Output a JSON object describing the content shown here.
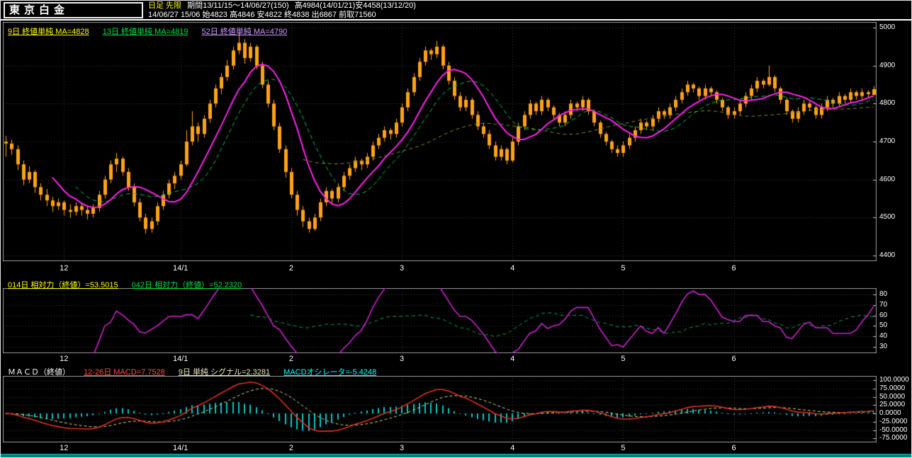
{
  "header": {
    "title": "東京白金",
    "timeframe": "日足 先限",
    "period": "期間13/11/15～14/06/27(150)",
    "period_high_low": "高4984(14/01/21)安4458(13/12/20)",
    "quote_line": "14/06/27 15/06 始4823 高4846 安4822 終4838 出6867 前取71560"
  },
  "colors": {
    "candle": "#ffa216",
    "ma9": "#ff22ee",
    "ma13": "#00c850",
    "ma52": "#8a8a20",
    "rsi14": "#cc22cc",
    "rsi42": "#00a050",
    "macd": "#e03020",
    "signal": "#d8d890",
    "histogram": "#00c8c8",
    "grid": "#3a3a3a",
    "frame": "#9a9a9a",
    "yellow": "#ffff00",
    "statusbar": "#008080"
  },
  "panels": {
    "main": {
      "legend": [
        {
          "label": "9日 終値単純 MA=4828",
          "color": "#ffff00"
        },
        {
          "label": "13日 終値単純 MA=4819",
          "color": "#00dd44"
        },
        {
          "label": "52日 終値単純 MA=4790",
          "color": "#cc99ff"
        }
      ],
      "y_ticks": [
        {
          "v": 5000,
          "label": "5000"
        },
        {
          "v": 4900,
          "label": "4900"
        },
        {
          "v": 4800,
          "label": "4800"
        },
        {
          "v": 4700,
          "label": "4700"
        },
        {
          "v": 4600,
          "label": "4600"
        },
        {
          "v": 4500,
          "label": "4500"
        },
        {
          "v": 4400,
          "label": "4400"
        }
      ]
    },
    "rsi": {
      "legend": [
        {
          "label": "014日 相対力（終値）=53.5015",
          "color": "#ffff00"
        },
        {
          "label": "042日 相対力（終値）=52.2320",
          "color": "#00dd44"
        }
      ],
      "y_ticks": [
        {
          "v": 80,
          "label": "80"
        },
        {
          "v": 70,
          "label": "70"
        },
        {
          "v": 60,
          "label": "60"
        },
        {
          "v": 50,
          "label": "50"
        },
        {
          "v": 40,
          "label": "40"
        },
        {
          "v": 30,
          "label": "30"
        }
      ]
    },
    "macd": {
      "legend": [
        {
          "label": "ＭＡＣＤ（終値）",
          "color": "#ffffff"
        },
        {
          "label": "12-26日 MACD=7.7528",
          "color": "#ff5040"
        },
        {
          "label": "9日 単純 シグナル=2.3281",
          "color": "#e8e8c0"
        },
        {
          "label": "MACDオシレータ=-5.4248",
          "color": "#00ffff"
        }
      ],
      "y_ticks": [
        {
          "v": 100,
          "label": "100.0000"
        },
        {
          "v": 75,
          "label": "75.0000"
        },
        {
          "v": 50,
          "label": "50.0000"
        },
        {
          "v": 25,
          "label": "25.0000"
        },
        {
          "v": 0,
          "label": "0.0000"
        },
        {
          "v": -25,
          "label": "-25.0000"
        },
        {
          "v": -50,
          "label": "-50.0000"
        },
        {
          "v": -75,
          "label": "-75.0000"
        }
      ]
    }
  },
  "chart_data": [
    {
      "type": "candlestick",
      "title": "東京白金 日足 先限",
      "ylim": [
        4400,
        5000
      ],
      "period_high": 4984,
      "period_low": 4458,
      "x_ticks": [
        {
          "label": "12",
          "i": 10
        },
        {
          "label": "14/1",
          "i": 30
        },
        {
          "label": "2",
          "i": 49
        },
        {
          "label": "3",
          "i": 68
        },
        {
          "label": "4",
          "i": 87
        },
        {
          "label": "5",
          "i": 106
        },
        {
          "label": "6",
          "i": 125
        }
      ],
      "moving_averages": [
        {
          "period": 9,
          "type": "終値単純",
          "last": 4828
        },
        {
          "period": 13,
          "type": "終値単純",
          "last": 4819
        },
        {
          "period": 52,
          "type": "終値単純",
          "last": 4790
        }
      ],
      "candles": [
        [
          4700,
          4715,
          4660,
          4695
        ],
        [
          4695,
          4705,
          4665,
          4680
        ],
        [
          4680,
          4690,
          4625,
          4640
        ],
        [
          4640,
          4650,
          4585,
          4600
        ],
        [
          4600,
          4635,
          4590,
          4620
        ],
        [
          4620,
          4625,
          4565,
          4580
        ],
        [
          4580,
          4590,
          4545,
          4560
        ],
        [
          4560,
          4575,
          4530,
          4545
        ],
        [
          4545,
          4555,
          4515,
          4530
        ],
        [
          4530,
          4550,
          4520,
          4540
        ],
        [
          4540,
          4545,
          4505,
          4520
        ],
        [
          4520,
          4535,
          4500,
          4515
        ],
        [
          4515,
          4540,
          4505,
          4530
        ],
        [
          4530,
          4540,
          4505,
          4520
        ],
        [
          4520,
          4530,
          4495,
          4510
        ],
        [
          4510,
          4535,
          4500,
          4525
        ],
        [
          4525,
          4570,
          4515,
          4560
        ],
        [
          4560,
          4610,
          4550,
          4600
        ],
        [
          4600,
          4650,
          4590,
          4640
        ],
        [
          4640,
          4670,
          4620,
          4655
        ],
        [
          4655,
          4660,
          4610,
          4620
        ],
        [
          4620,
          4630,
          4570,
          4580
        ],
        [
          4580,
          4590,
          4530,
          4540
        ],
        [
          4540,
          4550,
          4490,
          4500
        ],
        [
          4500,
          4510,
          4458,
          4470
        ],
        [
          4470,
          4500,
          4460,
          4490
        ],
        [
          4490,
          4540,
          4480,
          4530
        ],
        [
          4530,
          4570,
          4520,
          4560
        ],
        [
          4560,
          4600,
          4550,
          4590
        ],
        [
          4590,
          4620,
          4575,
          4610
        ],
        [
          4610,
          4650,
          4600,
          4640
        ],
        [
          4640,
          4730,
          4635,
          4700
        ],
        [
          4700,
          4780,
          4690,
          4740
        ],
        [
          4740,
          4750,
          4700,
          4720
        ],
        [
          4720,
          4770,
          4710,
          4760
        ],
        [
          4760,
          4810,
          4750,
          4800
        ],
        [
          4800,
          4850,
          4790,
          4840
        ],
        [
          4840,
          4880,
          4825,
          4870
        ],
        [
          4870,
          4915,
          4860,
          4900
        ],
        [
          4900,
          4950,
          4890,
          4940
        ],
        [
          4940,
          4984,
          4930,
          4960
        ],
        [
          4960,
          4970,
          4905,
          4920
        ],
        [
          4920,
          4960,
          4910,
          4950
        ],
        [
          4950,
          4955,
          4890,
          4900
        ],
        [
          4900,
          4910,
          4840,
          4850
        ],
        [
          4850,
          4860,
          4790,
          4800
        ],
        [
          4800,
          4810,
          4730,
          4740
        ],
        [
          4740,
          4750,
          4670,
          4680
        ],
        [
          4680,
          4690,
          4605,
          4620
        ],
        [
          4620,
          4630,
          4550,
          4560
        ],
        [
          4560,
          4570,
          4505,
          4520
        ],
        [
          4520,
          4530,
          4475,
          4490
        ],
        [
          4490,
          4500,
          4460,
          4470
        ],
        [
          4470,
          4510,
          4465,
          4500
        ],
        [
          4500,
          4550,
          4490,
          4540
        ],
        [
          4540,
          4580,
          4530,
          4570
        ],
        [
          4570,
          4575,
          4535,
          4550
        ],
        [
          4550,
          4590,
          4540,
          4580
        ],
        [
          4580,
          4620,
          4570,
          4610
        ],
        [
          4610,
          4640,
          4600,
          4630
        ],
        [
          4630,
          4660,
          4620,
          4650
        ],
        [
          4650,
          4655,
          4625,
          4640
        ],
        [
          4640,
          4670,
          4630,
          4660
        ],
        [
          4660,
          4700,
          4650,
          4690
        ],
        [
          4690,
          4720,
          4680,
          4710
        ],
        [
          4710,
          4740,
          4700,
          4730
        ],
        [
          4730,
          4735,
          4705,
          4720
        ],
        [
          4720,
          4760,
          4710,
          4750
        ],
        [
          4750,
          4800,
          4740,
          4790
        ],
        [
          4790,
          4840,
          4780,
          4830
        ],
        [
          4830,
          4880,
          4820,
          4870
        ],
        [
          4870,
          4920,
          4860,
          4910
        ],
        [
          4910,
          4950,
          4900,
          4940
        ],
        [
          4940,
          4945,
          4915,
          4930
        ],
        [
          4930,
          4965,
          4920,
          4950
        ],
        [
          4950,
          4955,
          4890,
          4900
        ],
        [
          4900,
          4910,
          4850,
          4860
        ],
        [
          4860,
          4870,
          4810,
          4820
        ],
        [
          4820,
          4830,
          4780,
          4790
        ],
        [
          4790,
          4820,
          4780,
          4810
        ],
        [
          4810,
          4815,
          4760,
          4770
        ],
        [
          4770,
          4780,
          4730,
          4740
        ],
        [
          4740,
          4750,
          4710,
          4720
        ],
        [
          4720,
          4730,
          4680,
          4690
        ],
        [
          4690,
          4700,
          4650,
          4660
        ],
        [
          4660,
          4690,
          4650,
          4680
        ],
        [
          4680,
          4685,
          4640,
          4650
        ],
        [
          4650,
          4710,
          4645,
          4700
        ],
        [
          4700,
          4750,
          4690,
          4740
        ],
        [
          4740,
          4780,
          4730,
          4770
        ],
        [
          4770,
          4810,
          4760,
          4800
        ],
        [
          4800,
          4805,
          4770,
          4780
        ],
        [
          4780,
          4820,
          4770,
          4810
        ],
        [
          4810,
          4815,
          4780,
          4790
        ],
        [
          4790,
          4795,
          4760,
          4770
        ],
        [
          4770,
          4775,
          4740,
          4750
        ],
        [
          4750,
          4780,
          4740,
          4770
        ],
        [
          4770,
          4810,
          4760,
          4800
        ],
        [
          4800,
          4805,
          4780,
          4790
        ],
        [
          4790,
          4820,
          4780,
          4810
        ],
        [
          4810,
          4815,
          4770,
          4780
        ],
        [
          4780,
          4785,
          4740,
          4750
        ],
        [
          4750,
          4755,
          4710,
          4720
        ],
        [
          4720,
          4725,
          4690,
          4700
        ],
        [
          4700,
          4705,
          4670,
          4680
        ],
        [
          4680,
          4690,
          4660,
          4670
        ],
        [
          4670,
          4700,
          4660,
          4690
        ],
        [
          4690,
          4720,
          4680,
          4710
        ],
        [
          4710,
          4740,
          4700,
          4730
        ],
        [
          4730,
          4760,
          4720,
          4750
        ],
        [
          4750,
          4755,
          4730,
          4740
        ],
        [
          4740,
          4770,
          4730,
          4760
        ],
        [
          4760,
          4790,
          4750,
          4780
        ],
        [
          4780,
          4785,
          4760,
          4770
        ],
        [
          4770,
          4800,
          4760,
          4790
        ],
        [
          4790,
          4820,
          4780,
          4810
        ],
        [
          4810,
          4840,
          4800,
          4830
        ],
        [
          4830,
          4860,
          4820,
          4850
        ],
        [
          4850,
          4855,
          4830,
          4840
        ],
        [
          4840,
          4845,
          4810,
          4820
        ],
        [
          4820,
          4850,
          4810,
          4840
        ],
        [
          4840,
          4845,
          4820,
          4830
        ],
        [
          4830,
          4835,
          4800,
          4810
        ],
        [
          4810,
          4815,
          4780,
          4790
        ],
        [
          4790,
          4795,
          4760,
          4770
        ],
        [
          4770,
          4790,
          4760,
          4780
        ],
        [
          4780,
          4810,
          4770,
          4800
        ],
        [
          4800,
          4830,
          4790,
          4820
        ],
        [
          4820,
          4850,
          4810,
          4840
        ],
        [
          4840,
          4870,
          4830,
          4860
        ],
        [
          4860,
          4865,
          4840,
          4850
        ],
        [
          4850,
          4900,
          4845,
          4870
        ],
        [
          4870,
          4875,
          4830,
          4840
        ],
        [
          4840,
          4845,
          4800,
          4810
        ],
        [
          4810,
          4815,
          4770,
          4780
        ],
        [
          4780,
          4785,
          4750,
          4760
        ],
        [
          4760,
          4790,
          4750,
          4780
        ],
        [
          4780,
          4810,
          4770,
          4800
        ],
        [
          4800,
          4805,
          4780,
          4790
        ],
        [
          4790,
          4795,
          4760,
          4770
        ],
        [
          4770,
          4800,
          4760,
          4790
        ],
        [
          4790,
          4820,
          4780,
          4810
        ],
        [
          4810,
          4815,
          4790,
          4800
        ],
        [
          4800,
          4830,
          4790,
          4820
        ],
        [
          4820,
          4825,
          4800,
          4810
        ],
        [
          4810,
          4840,
          4800,
          4830
        ],
        [
          4830,
          4835,
          4810,
          4820
        ],
        [
          4820,
          4840,
          4810,
          4830
        ],
        [
          4830,
          4835,
          4815,
          4825
        ],
        [
          4823,
          4846,
          4822,
          4838
        ]
      ]
    },
    {
      "type": "line",
      "title": "相対力 (RSI)",
      "ylim": [
        30,
        80
      ],
      "series": [
        {
          "name": "014日 相対力（終値）",
          "period": 14,
          "last": 53.5015
        },
        {
          "name": "042日 相対力（終値）",
          "period": 42,
          "last": 52.232
        }
      ]
    },
    {
      "type": "macd",
      "title": "MACD（終値）",
      "ylim": [
        -75,
        100
      ],
      "params": {
        "fast": 12,
        "slow": 26,
        "signal": 9
      },
      "last": {
        "macd": 7.7528,
        "signal": 2.3281,
        "oscillator": -5.4248
      }
    }
  ]
}
